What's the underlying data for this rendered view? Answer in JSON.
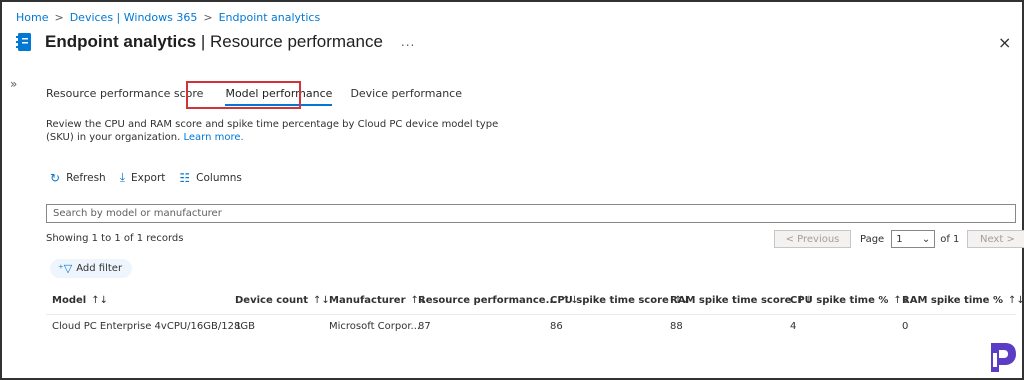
{
  "breadcrumb": [
    "Home",
    "Devices | Windows 365",
    "Endpoint analytics"
  ],
  "header": {
    "title_main": "Endpoint analytics",
    "title_sub": " | Resource performance",
    "more": "...",
    "close": "×"
  },
  "tabs": [
    {
      "label": "Resource performance score",
      "active": false
    },
    {
      "label": "Model performance",
      "active": true
    },
    {
      "label": "Device performance",
      "active": false
    }
  ],
  "description": {
    "text": "Review the CPU and RAM score and spike time percentage by Cloud PC device model type (SKU) in your organization.",
    "link": "Learn more."
  },
  "toolbar": {
    "refresh": "Refresh",
    "export": "Export",
    "columns": "Columns"
  },
  "search": {
    "placeholder": "Search by model or manufacturer"
  },
  "records": "Showing 1 to 1 of 1 records",
  "pager": {
    "previous": "< Previous",
    "page_label": "Page",
    "page_value": "1",
    "of": "of 1",
    "next": "Next >"
  },
  "filter": {
    "label": "Add filter"
  },
  "table": {
    "headers": [
      "Model",
      "Device count",
      "Manufacturer",
      "Resource performance...",
      "CPU spike time score",
      "RAM spike time score",
      "CPU spike time %",
      "RAM spike time %"
    ],
    "sort_glyph": "↑↓",
    "rows": [
      [
        "Cloud PC Enterprise 4vCPU/16GB/128GB",
        "1",
        "Microsoft Corpor...",
        "87",
        "86",
        "88",
        "4",
        "0"
      ]
    ]
  },
  "colors": {
    "accent": "#0078d4",
    "highlight": "#d13438",
    "logo": "#5b3cc4"
  }
}
